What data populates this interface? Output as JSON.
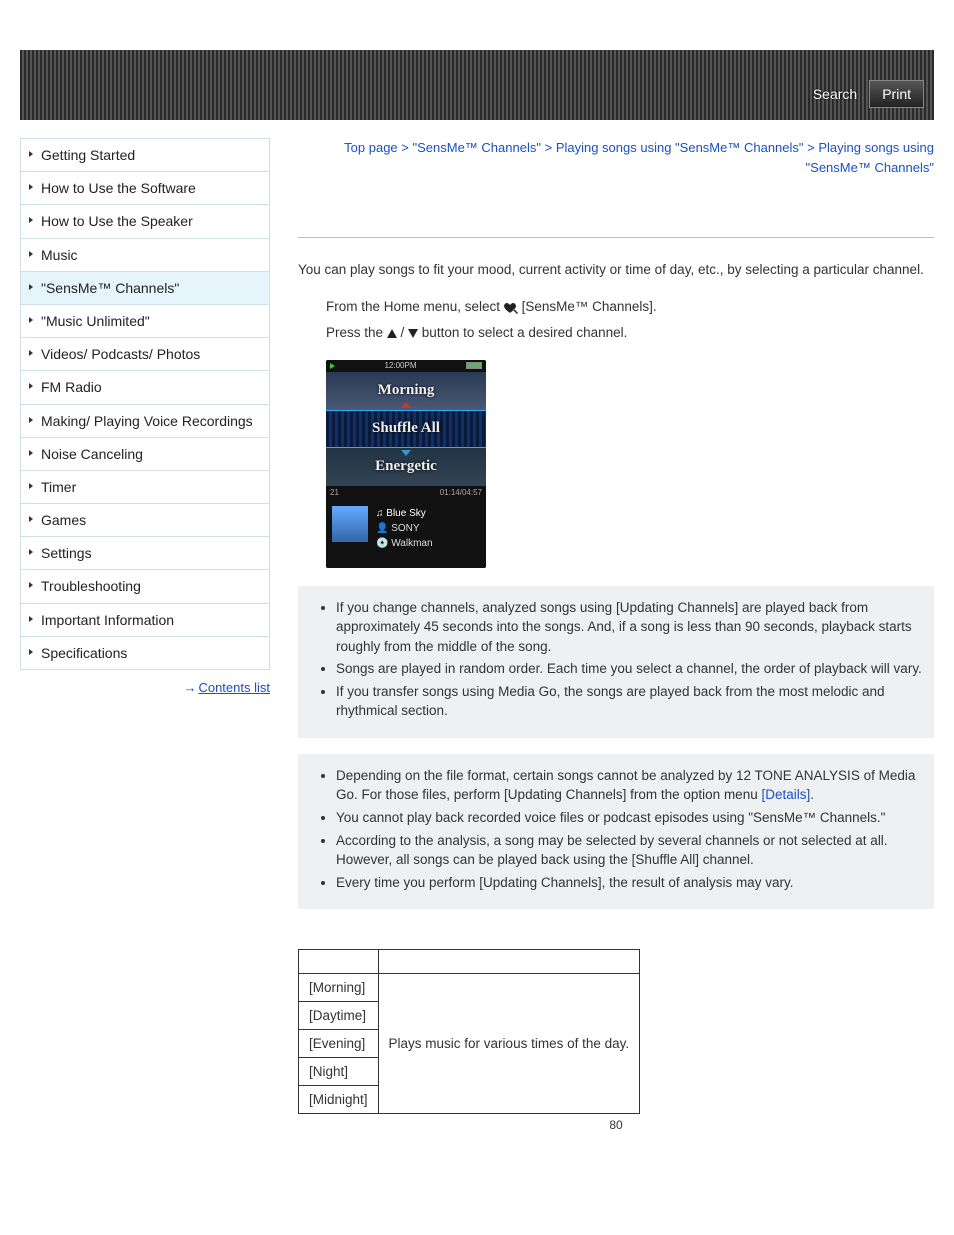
{
  "header": {
    "search": "Search",
    "print": "Print"
  },
  "sidebar": {
    "items": [
      "Getting Started",
      "How to Use the Software",
      "How to Use the Speaker",
      "Music",
      "\"SensMe™ Channels\"",
      "\"Music Unlimited\"",
      "Videos/ Podcasts/ Photos",
      "FM Radio",
      "Making/ Playing Voice Recordings",
      "Noise Canceling",
      "Timer",
      "Games",
      "Settings",
      "Troubleshooting",
      "Important Information",
      "Specifications"
    ],
    "active_index": 4,
    "contents_link": "Contents list"
  },
  "breadcrumb": {
    "parts": [
      "Top page",
      "\"SensMe™ Channels\"",
      "Playing songs using \"SensMe™ Channels\"",
      "Playing songs using \"SensMe™ Channels\""
    ],
    "sep": ">"
  },
  "intro": "You can play songs to fit your mood, current activity or time of day, etc., by selecting a particular channel.",
  "steps": {
    "s1_a": "From the Home menu, select ",
    "s1_b": " [SensMe™ Channels].",
    "s2_a": "Press the ",
    "s2_mid": " / ",
    "s2_b": " button to select a desired channel."
  },
  "screenshot": {
    "time": "12:00PM",
    "rows": [
      "Morning",
      "Shuffle All",
      "Energetic"
    ],
    "count": "21",
    "elapsed": "01:14/04:57",
    "track": "Blue Sky",
    "artist": "SONY",
    "album": "Walkman"
  },
  "hints": [
    "If you change channels, analyzed songs using [Updating Channels] are played back from approximately 45 seconds into the songs. And, if a song is less than 90 seconds, playback starts roughly from the middle of the song.",
    "Songs are played in random order. Each time you select a channel, the order of playback will vary.",
    "If you transfer songs using Media Go, the songs are played back from the most melodic and rhythmical section."
  ],
  "notes": {
    "n1_a": "Depending on the file format, certain songs cannot be analyzed by 12 TONE ANALYSIS of Media Go. For those files, perform [Updating Channels] from the option menu ",
    "n1_link": "[Details]",
    "n1_b": ".",
    "n2": "You cannot play back recorded voice files or podcast episodes using \"SensMe™ Channels.\"",
    "n3": "According to the analysis, a song may be selected by several channels or not selected at all. However, all songs can be played back using the [Shuffle All] channel.",
    "n4": "Every time you perform [Updating Channels], the result of analysis may vary."
  },
  "table": {
    "rows": [
      "[Morning]",
      "[Daytime]",
      "[Evening]",
      "[Night]",
      "[Midnight]"
    ],
    "desc": "Plays music for various times of the day."
  },
  "page_number": "80"
}
